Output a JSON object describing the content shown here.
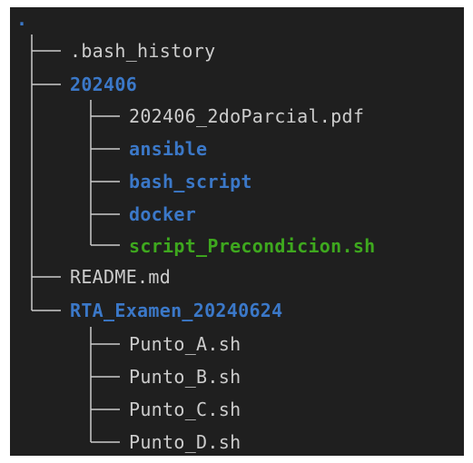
{
  "tree": {
    "root": ".",
    "items": [
      {
        "name": ".bash_history",
        "kind": "file"
      },
      {
        "name": "202406",
        "kind": "dir"
      },
      {
        "name": "202406_2doParcial.pdf",
        "kind": "file"
      },
      {
        "name": "ansible",
        "kind": "dir"
      },
      {
        "name": "bash_script",
        "kind": "dir"
      },
      {
        "name": "docker",
        "kind": "dir"
      },
      {
        "name": "script_Precondicion.sh",
        "kind": "exec"
      },
      {
        "name": "README.md",
        "kind": "file"
      },
      {
        "name": "RTA_Examen_20240624",
        "kind": "dir"
      },
      {
        "name": "Punto_A.sh",
        "kind": "file"
      },
      {
        "name": "Punto_B.sh",
        "kind": "file"
      },
      {
        "name": "Punto_C.sh",
        "kind": "file"
      },
      {
        "name": "Punto_D.sh",
        "kind": "file"
      }
    ]
  },
  "colors": {
    "background": "#1f1f1f",
    "text": "#cccccc",
    "directory": "#3b78c8",
    "executable": "#3ea81e"
  }
}
